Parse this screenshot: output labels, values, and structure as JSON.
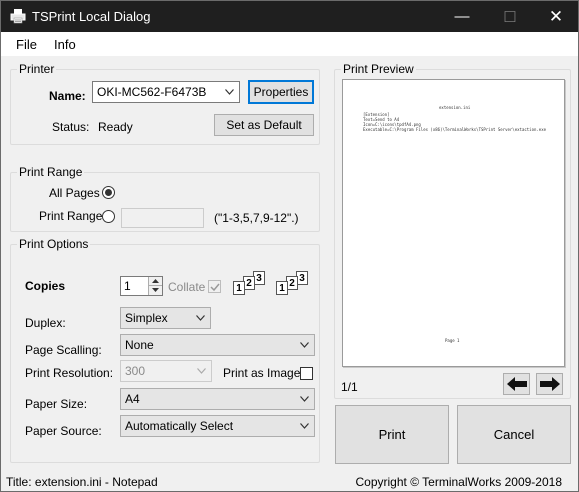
{
  "window": {
    "title": "TSPrint Local Dialog",
    "controls": {
      "minimize": "—",
      "maximize": "☐",
      "close": "✕"
    }
  },
  "menu": {
    "items": [
      "File",
      "Info"
    ]
  },
  "printer": {
    "legend": "Printer",
    "name_label": "Name:",
    "name_value": "OKI-MC562-F6473B",
    "properties_button": "Properties",
    "status_label": "Status:",
    "status_value": "Ready",
    "default_button": "Set as Default"
  },
  "print_range": {
    "legend": "Print Range",
    "all_pages_label": "All Pages",
    "all_pages_selected": true,
    "range_label": "Print Range",
    "range_value": "",
    "range_hint": "(\"1-3,5,7,9-12\".)"
  },
  "print_options": {
    "legend": "Print Options",
    "copies_label": "Copies",
    "copies_value": "1",
    "collate_label": "Collate",
    "collate_checked": true,
    "duplex_label": "Duplex:",
    "duplex_value": "Simplex",
    "scaling_label": "Page Scalling:",
    "scaling_value": "None",
    "resolution_label": "Print Resolution:",
    "resolution_value": "300",
    "print_as_image_label": "Print as Image",
    "print_as_image_checked": false,
    "paper_size_label": "Paper Size:",
    "paper_size_value": "A4",
    "paper_source_label": "Paper Source:",
    "paper_source_value": "Automatically Select",
    "collate_icon_pages": [
      "1",
      "2",
      "3"
    ]
  },
  "preview": {
    "legend": "Print Preview",
    "page_indicator": "1/1",
    "prev_icon": "arrow-left-icon",
    "next_icon": "arrow-right-icon",
    "page_header": "extension.ini",
    "page_lines": [
      "[Extension]",
      "Text=Send to A4",
      "Icon=C:\\icons\\tpdfA4.png",
      "Executable=C:\\Program Files (x86)\\TerminalWorks\\TSPrint Server\\extaction.exe"
    ],
    "page_footer": "Page 1"
  },
  "actions": {
    "print": "Print",
    "cancel": "Cancel"
  },
  "status_bar": {
    "left": "Title: extension.ini - Notepad",
    "right": "Copyright © TerminalWorks 2009-2018"
  }
}
